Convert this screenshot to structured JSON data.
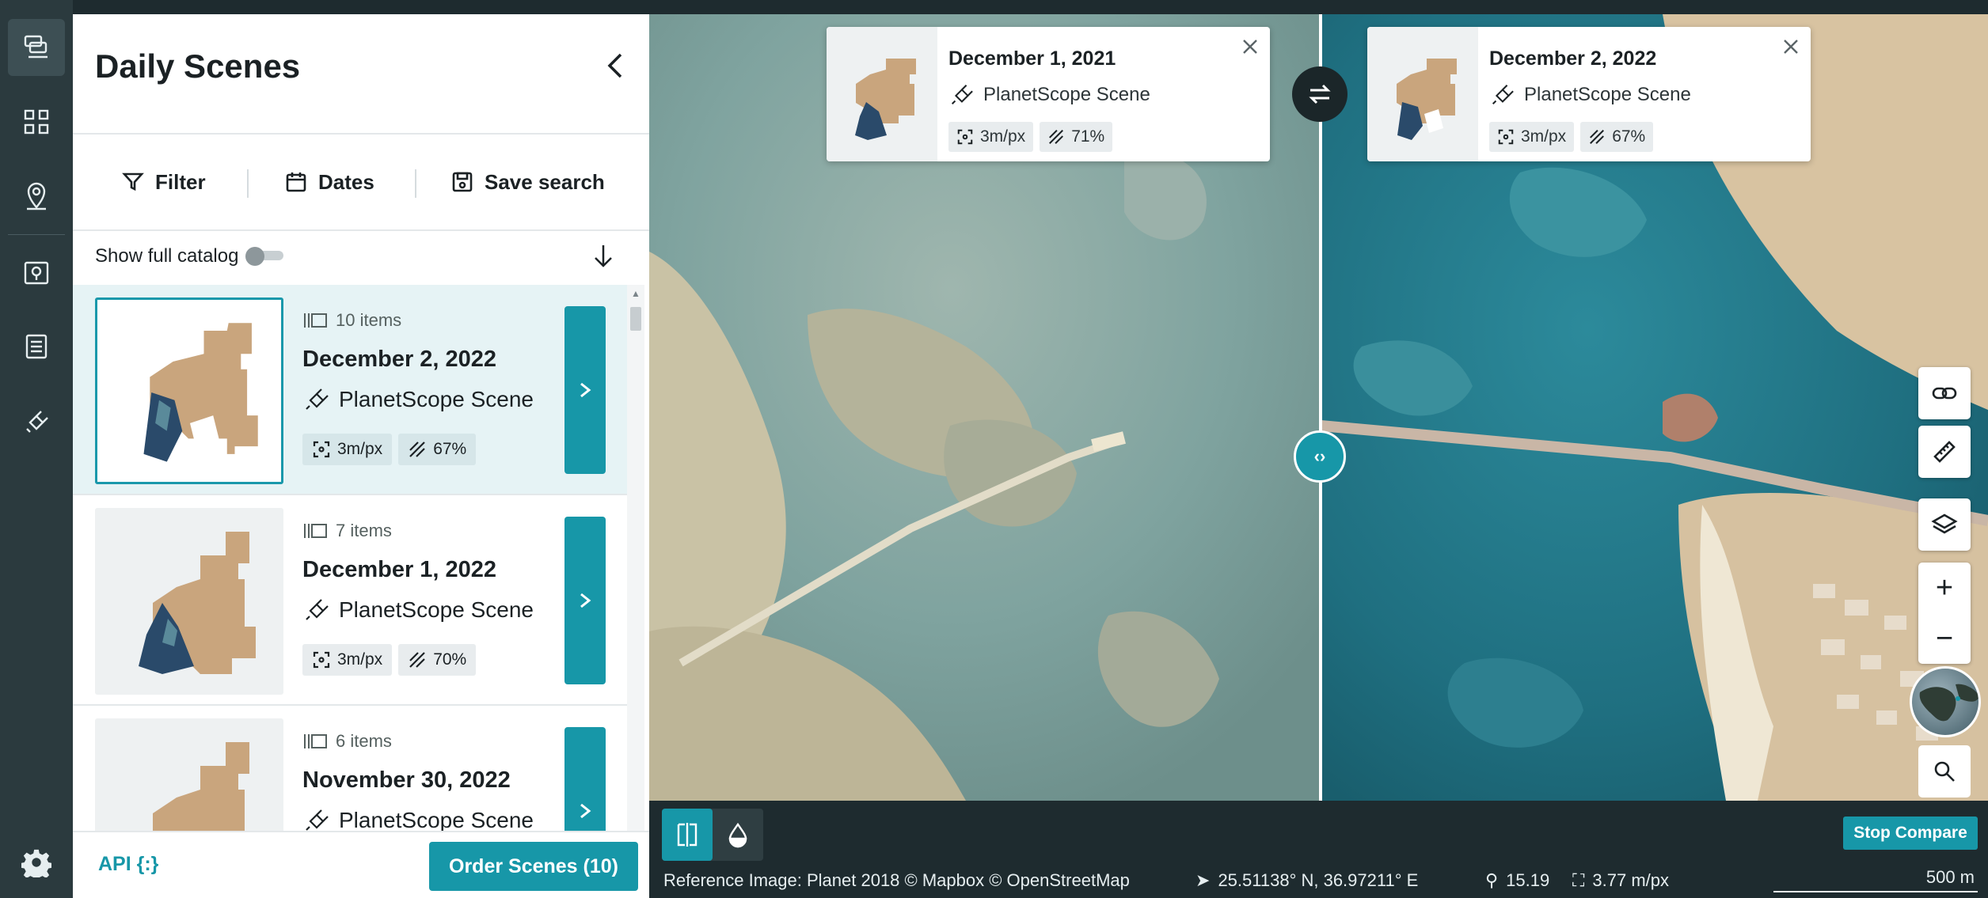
{
  "panel": {
    "title": "Daily Scenes",
    "toolbar": {
      "filter": "Filter",
      "dates": "Dates",
      "save_search": "Save search"
    },
    "show_full_catalog": "Show full catalog",
    "cards": [
      {
        "items": "10 items",
        "date": "December 2, 2022",
        "type": "PlanetScope Scene",
        "resolution": "3m/px",
        "cloud": "67%",
        "selected": true
      },
      {
        "items": "7 items",
        "date": "December 1, 2022",
        "type": "PlanetScope Scene",
        "resolution": "3m/px",
        "cloud": "70%",
        "selected": false
      },
      {
        "items": "6 items",
        "date": "November 30, 2022",
        "type": "PlanetScope Scene",
        "resolution": "",
        "cloud": "",
        "selected": false
      }
    ],
    "footer": {
      "api": "API {:}",
      "order": "Order Scenes (10)"
    }
  },
  "rail": {
    "icons": [
      "layers-stack-icon",
      "qr-grid-icon",
      "location-pin-icon",
      "map-pin-area-icon",
      "document-list-icon",
      "satellite-icon",
      "gear-icon"
    ]
  },
  "compare": {
    "left": {
      "date": "December 1, 2021",
      "type": "PlanetScope Scene",
      "resolution": "3m/px",
      "cloud": "71%"
    },
    "right": {
      "date": "December 2, 2022",
      "type": "PlanetScope Scene",
      "resolution": "3m/px",
      "cloud": "67%"
    },
    "split_handle": "‹›",
    "stop_compare": "Stop Compare"
  },
  "status": {
    "reference": "Reference Image: Planet 2018 © Mapbox © OpenStreetMap",
    "coordinates": "25.51138° N, 36.97211° E",
    "zoom": "15.19",
    "resolution": "3.77 m/px",
    "scale": "500 m"
  },
  "colors": {
    "accent": "#1797a8",
    "rail": "#2b3a3e",
    "panel": "#ffffff",
    "selected_card": "#e6f3f5"
  }
}
